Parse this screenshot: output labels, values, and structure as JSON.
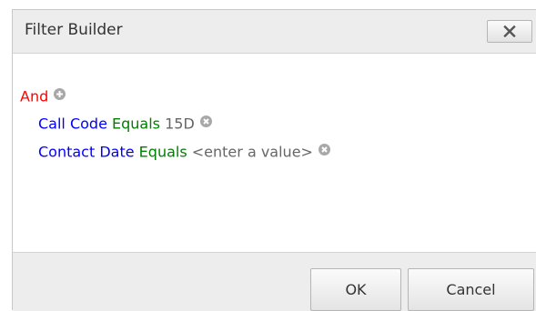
{
  "dialog": {
    "title": "Filter Builder",
    "close_label": "X"
  },
  "filter": {
    "group_operator": "And",
    "conditions": [
      {
        "field": "Call Code",
        "operator": "Equals",
        "value": "15D"
      },
      {
        "field": "Contact Date",
        "operator": "Equals",
        "value": "<enter a value>"
      }
    ]
  },
  "buttons": {
    "ok_label": "OK",
    "cancel_label": "Cancel"
  },
  "colors": {
    "group_operator": "#ff0000",
    "field": "#0000ff",
    "operator": "#008000",
    "value": "#666666"
  },
  "icons": {
    "add": "plus-circle-icon",
    "remove": "x-circle-icon",
    "close": "close-icon"
  }
}
